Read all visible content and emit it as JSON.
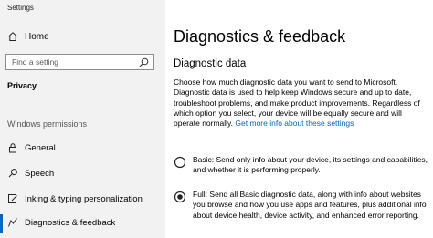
{
  "window": {
    "title": "Settings"
  },
  "sidebar": {
    "home_label": "Home",
    "search_placeholder": "Find a setting",
    "section_privacy": "Privacy",
    "section_windows_permissions": "Windows permissions",
    "items": [
      {
        "label": "General",
        "icon": "lock-icon"
      },
      {
        "label": "Speech",
        "icon": "microphone-icon"
      },
      {
        "label": "Inking & typing personalization",
        "icon": "inking-icon"
      },
      {
        "label": "Diagnostics & feedback",
        "icon": "feedback-icon",
        "selected": true
      }
    ]
  },
  "main": {
    "page_title": "Diagnostics & feedback",
    "section_title": "Diagnostic data",
    "description": "Choose how much diagnostic data you want to send to Microsoft. Diagnostic data is used to help keep Windows secure and up to date, troubleshoot problems, and make product improvements. Regardless of which option you select, your device will be equally secure and will operate normally.",
    "description_link": "Get more info about these settings",
    "options": [
      {
        "text": "Basic: Send only info about your device, its settings and capabilities, and whether it is performing properly.",
        "selected": false
      },
      {
        "text": "Full: Send all Basic diagnostic data, along with info about websites you browse and how you use apps and features, plus additional info about device health, device activity, and enhanced error reporting.",
        "selected": true
      }
    ]
  },
  "colors": {
    "accent": "#0067c0",
    "sidebar_bg": "#f2f2f2",
    "content_bg": "#ffffff"
  }
}
